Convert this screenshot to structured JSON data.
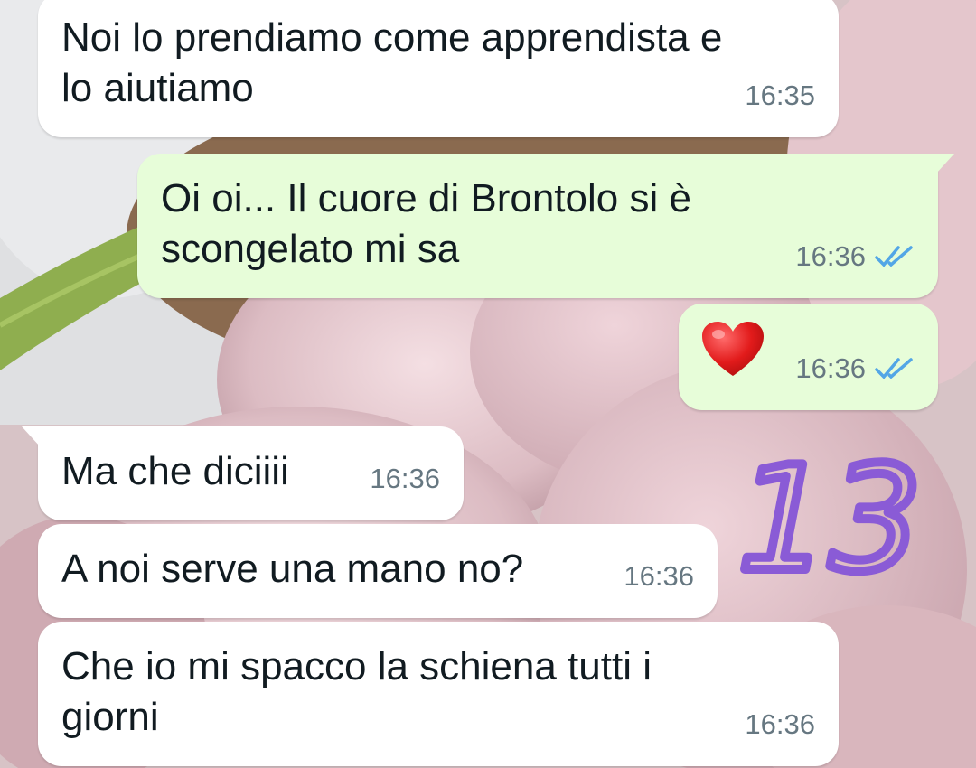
{
  "messages": [
    {
      "text": "Noi lo prendiamo come apprendista e\nlo aiutiamo",
      "time": "16:35",
      "direction": "incoming"
    },
    {
      "text": "Oi oi... Il cuore di Brontolo si è\nscongelato mi sa",
      "time": "16:36",
      "direction": "outgoing",
      "status": "read"
    },
    {
      "emoji": "heart-emoji",
      "time": "16:36",
      "direction": "outgoing",
      "status": "read"
    },
    {
      "text": "Ma che diciiii",
      "time": "16:36",
      "direction": "incoming"
    },
    {
      "text": "A noi serve una mano no?",
      "time": "16:36",
      "direction": "incoming"
    },
    {
      "text": "Che io mi spacco la schiena tutti i\ngiorni",
      "time": "16:36",
      "direction": "incoming"
    }
  ],
  "annotation": {
    "text": "13",
    "color": "#8a5bd6"
  },
  "colors": {
    "incoming_bubble": "#ffffff",
    "outgoing_bubble": "#e7fdd9",
    "read_ticks": "#53a6e6",
    "timestamp": "#667781"
  },
  "icons": {
    "read_receipt": "double-check-icon",
    "heart": "heart-emoji"
  }
}
